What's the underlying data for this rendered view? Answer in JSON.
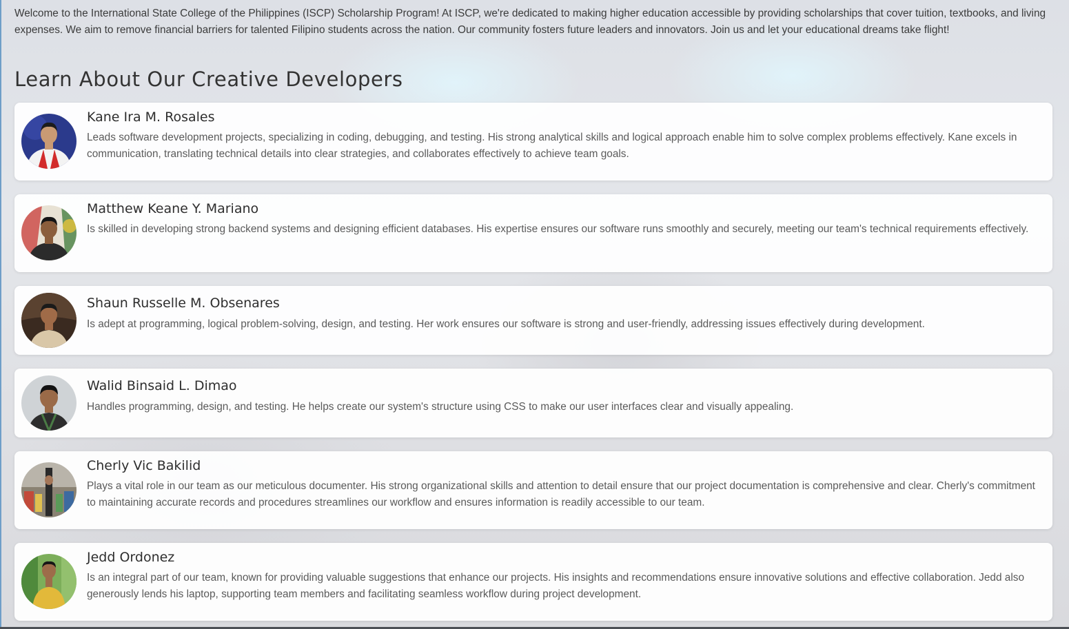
{
  "intro": {
    "text": "Welcome to the International State College of the Philippines (ISCP) Scholarship Program! At ISCP, we're dedicated to making higher education accessible by providing scholarships that cover tuition, textbooks, and living expenses. We aim to remove financial barriers for talented Filipino students across the nation. Our community fosters future leaders and innovators. Join us and let your educational dreams take flight!"
  },
  "developers_section": {
    "title": "Learn About Our Creative Developers",
    "items": [
      {
        "name": "Kane Ira M. Rosales",
        "description": "Leads software development projects, specializing in coding, debugging, and testing. His strong analytical skills and logical approach enable him to solve complex problems effectively. Kane excels in communication, translating technical details into clear strategies, and collaborates effectively to achieve team goals.",
        "photo_icon": "portrait-photo"
      },
      {
        "name": "Matthew Keane Y. Mariano",
        "description": "Is skilled in developing strong backend systems and designing efficient databases. His expertise ensures our software runs smoothly and securely, meeting our team's technical requirements effectively.",
        "photo_icon": "portrait-photo"
      },
      {
        "name": "Shaun Russelle M. Obsenares",
        "description": "Is adept at programming, logical problem-solving, design, and testing. Her work ensures our software is strong and user-friendly, addressing issues effectively during development.",
        "photo_icon": "portrait-photo"
      },
      {
        "name": "Walid Binsaid L. Dimao",
        "description": "Handles programming, design, and testing. He helps create our system's structure using CSS to make our user interfaces clear and visually appealing.",
        "photo_icon": "portrait-photo"
      },
      {
        "name": "Cherly Vic Bakilid",
        "description": "Plays a vital role in our team as our meticulous documenter. His strong organizational skills and attention to detail ensure that our project documentation is comprehensive and clear. Cherly's commitment to maintaining accurate records and procedures streamlines our workflow and ensures information is readily accessible to our team.",
        "photo_icon": "portrait-photo"
      },
      {
        "name": "Jedd Ordonez",
        "description": "Is an integral part of our team, known for providing valuable suggestions that enhance our projects. His insights and recommendations ensure innovative solutions and effective collaboration. Jedd also generously lends his laptop, supporting team members and facilitating seamless workflow during project development.",
        "photo_icon": "portrait-photo"
      }
    ]
  },
  "colors": {
    "card_background": "#ffffff",
    "text_primary": "#2e2e2e",
    "text_secondary": "#5a5a5a"
  }
}
